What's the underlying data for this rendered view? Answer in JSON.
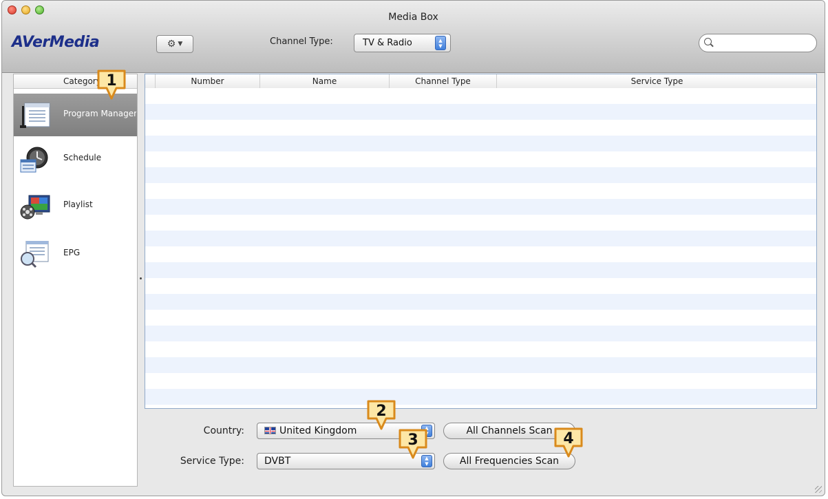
{
  "window": {
    "title": "Media Box"
  },
  "toolbar": {
    "logo": "AVerMedia",
    "channel_type_label": "Channel Type:",
    "channel_type_value": "TV & Radio",
    "search_placeholder": ""
  },
  "sidebar": {
    "header": "Category",
    "items": [
      {
        "label": "Program Manager",
        "icon": "program-manager-icon",
        "selected": true
      },
      {
        "label": "Schedule",
        "icon": "schedule-icon",
        "selected": false
      },
      {
        "label": "Playlist",
        "icon": "playlist-icon",
        "selected": false
      },
      {
        "label": "EPG",
        "icon": "epg-icon",
        "selected": false
      }
    ]
  },
  "table": {
    "columns": [
      "Number",
      "Name",
      "Channel Type",
      "Service Type"
    ],
    "rows": []
  },
  "form": {
    "country_label": "Country:",
    "country_value": "United Kingdom",
    "service_type_label": "Service Type:",
    "service_type_value": "DVBT",
    "all_channels_scan": "All Channels Scan",
    "all_frequencies_scan": "All Frequencies Scan"
  },
  "callouts": [
    "1",
    "2",
    "3",
    "4"
  ],
  "colors": {
    "callout_fill": "#fde7a6",
    "callout_stroke": "#d98a1c",
    "logo": "#1d2f8a",
    "row_stripe": "#edf3fd",
    "selected_item": "#8a8a8a"
  }
}
